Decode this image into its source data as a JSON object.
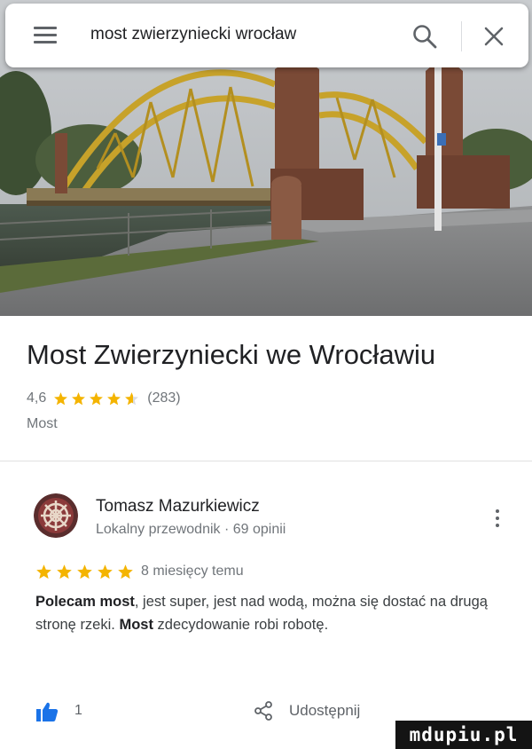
{
  "search": {
    "query": "most zwierzyniecki wrocław"
  },
  "icons": {
    "menu": "hamburger-menu-icon",
    "search": "search-icon",
    "close": "close-icon",
    "more": "more-vert-icon",
    "like": "thumbs-up-icon",
    "share": "share-icon",
    "star": "star-icon"
  },
  "place": {
    "title": "Most Zwierzyniecki we Wrocławiu",
    "rating": "4,6",
    "rating_stars": 4.6,
    "review_count": "(283)",
    "category": "Most"
  },
  "review": {
    "author": "Tomasz Mazurkiewicz",
    "author_meta": "Lokalny przewodnik · 69 opinii",
    "stars": 5,
    "time": "8 miesięcy temu",
    "text_parts": [
      {
        "bold": true,
        "text": "Polecam most"
      },
      {
        "bold": false,
        "text": ", jest super, jest nad wodą, można się dostać na drugą stronę rzeki. "
      },
      {
        "bold": true,
        "text": "Most"
      },
      {
        "bold": false,
        "text": " zdecydowanie robi robotę."
      }
    ],
    "likes": "1",
    "share_label": "Udostępnij"
  },
  "watermark": "mdupiu.pl",
  "colors": {
    "star": "#f4b400",
    "star_empty": "#dadce0",
    "text_secondary": "#70757a",
    "bridge_yellow": "#c7a22a",
    "brick": "#7a4a36"
  }
}
